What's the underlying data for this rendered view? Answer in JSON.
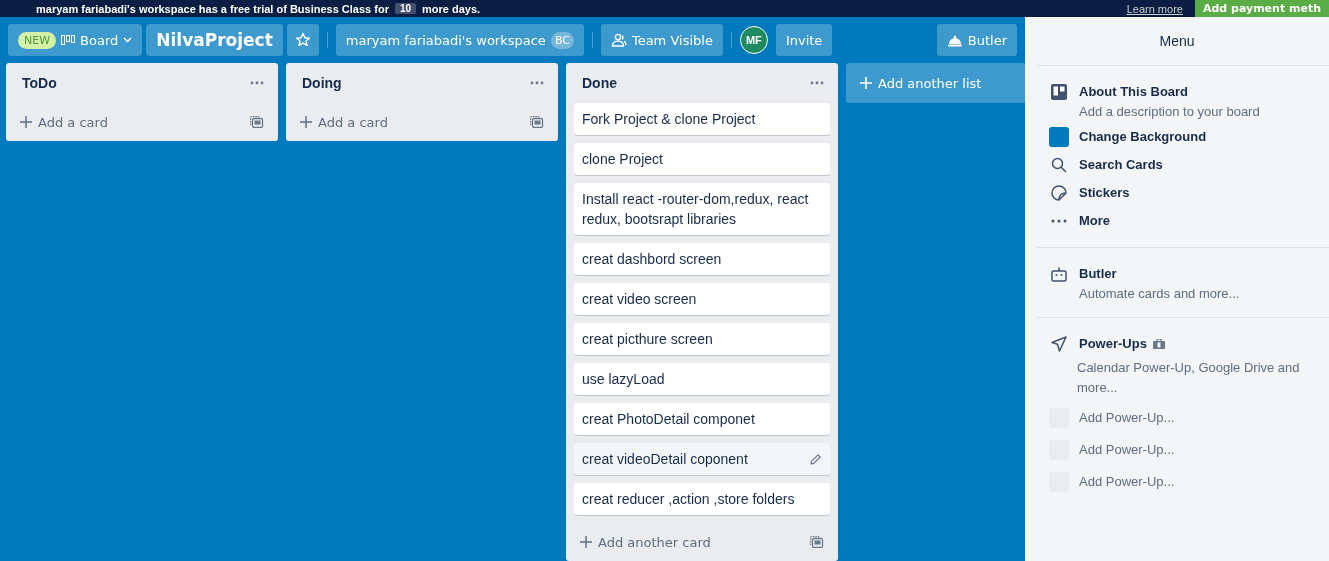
{
  "banner": {
    "message": "maryam fariabadi's workspace has a free trial of Business Class for",
    "days": "10",
    "suffix": "more days.",
    "link": "Learn more",
    "button": "Add payment meth"
  },
  "header": {
    "badge": "NEW",
    "view": "Board",
    "title": "NilvaProject",
    "starred": false,
    "workspace": "maryam fariabadi's workspace",
    "workspace_badge": "BC",
    "visibility": "Team Visible",
    "avatar": "MF",
    "invite": "Invite",
    "butler": "Butler"
  },
  "lists": [
    {
      "title": "ToDo",
      "add": "Add a card"
    },
    {
      "title": "Doing",
      "add": "Add a card"
    },
    {
      "title": "Done",
      "add": "Add another card",
      "cards": [
        {
          "text": "Fork Project & clone Project",
          "hovered": false
        },
        {
          "text": "clone Project",
          "hovered": false
        },
        {
          "text": "Install react -router-dom,redux, react redux, bootsrapt libraries",
          "hovered": false
        },
        {
          "text": "creat dashbord screen",
          "hovered": false
        },
        {
          "text": "creat video screen",
          "hovered": false
        },
        {
          "text": "creat picthure screen",
          "hovered": false
        },
        {
          "text": "use lazyLoad",
          "hovered": false
        },
        {
          "text": "creat PhotoDetail componet",
          "hovered": false
        },
        {
          "text": "creat videoDetail coponent",
          "hovered": true
        },
        {
          "text": "creat reducer ,action ,store folders",
          "hovered": false
        }
      ]
    }
  ],
  "add_list": "Add another list",
  "menu": {
    "title": "Menu",
    "items": [
      {
        "kind": "board",
        "label": "About This Board",
        "sub": "Add a description to your board"
      },
      {
        "kind": "background",
        "label": "Change Background",
        "color": "#0079bf"
      },
      {
        "kind": "search",
        "label": "Search Cards"
      },
      {
        "kind": "sticker",
        "label": "Stickers"
      },
      {
        "kind": "more",
        "label": "More"
      }
    ],
    "butler": {
      "label": "Butler",
      "sub": "Automate cards and more..."
    },
    "powerups": {
      "label": "Power-Ups",
      "sub": "Calendar Power-Up, Google Drive and more...",
      "slots": [
        "Add Power-Up...",
        "Add Power-Up...",
        "Add Power-Up..."
      ]
    }
  }
}
